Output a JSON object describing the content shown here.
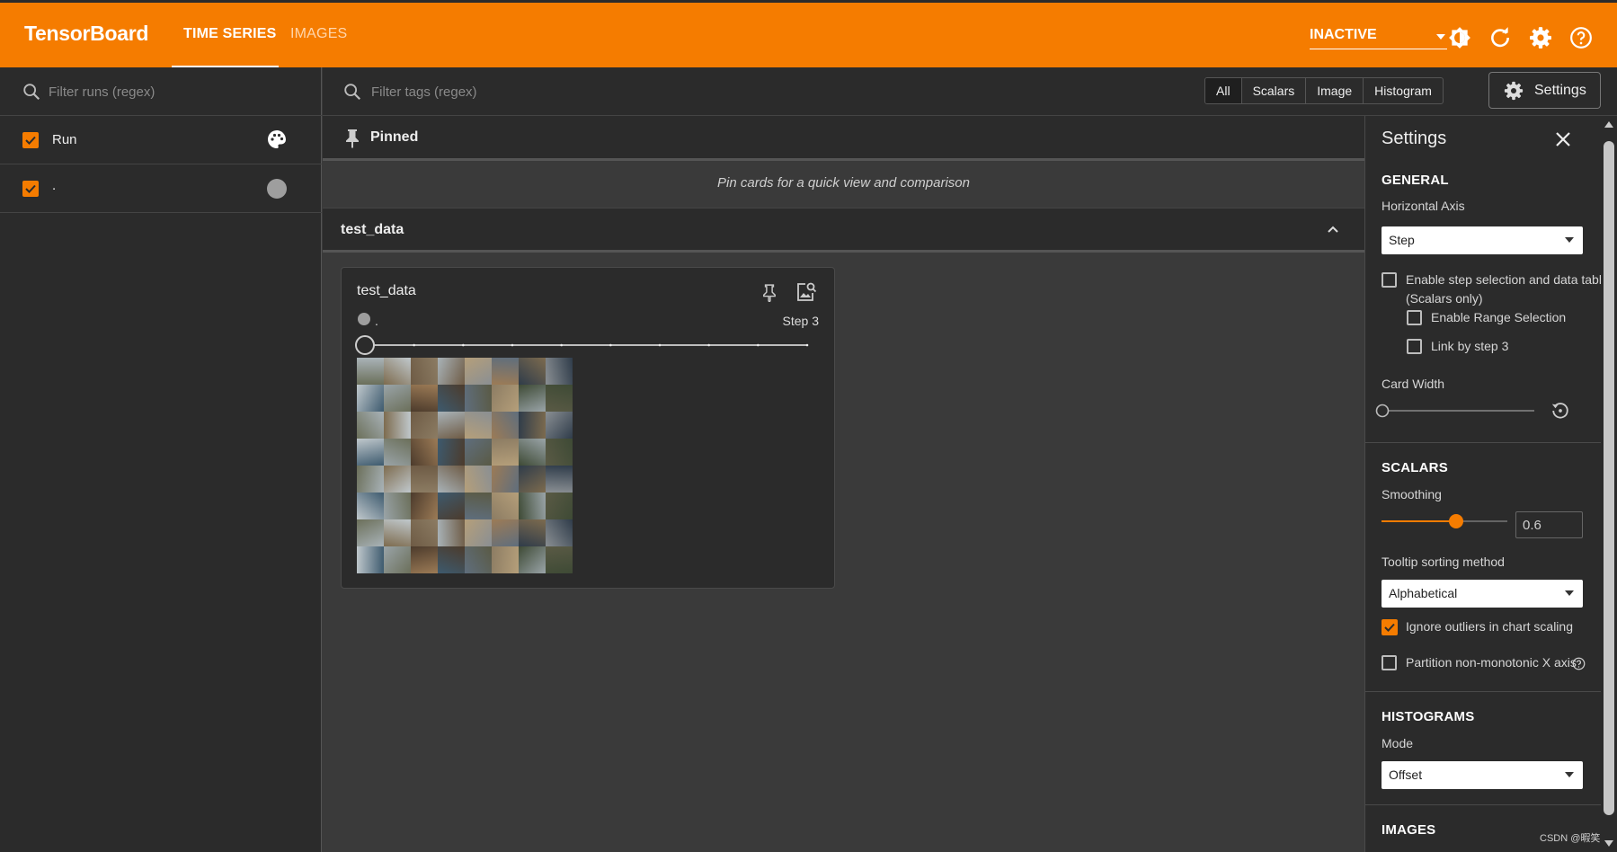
{
  "app": {
    "title": "TensorBoard"
  },
  "nav": {
    "tabs": [
      {
        "label": "TIME SERIES",
        "active": true
      },
      {
        "label": "IMAGES",
        "active": false
      }
    ],
    "reload_status": "INACTIVE"
  },
  "colors": {
    "accent": "#f57c00",
    "panel": "#2b2b2b",
    "background": "#3a3a3a"
  },
  "runs": {
    "filter_placeholder": "Filter runs (regex)",
    "header_label": "Run",
    "items": [
      {
        "name": ".",
        "checked": true,
        "color": "#9e9e9e"
      }
    ]
  },
  "main": {
    "filter_placeholder": "Filter tags (regex)",
    "type_filters": [
      "All",
      "Scalars",
      "Image",
      "Histogram"
    ],
    "settings_label": "Settings",
    "pinned": {
      "title": "Pinned",
      "empty_text": "Pin cards for a quick view and comparison"
    },
    "group": {
      "title": "test_data"
    },
    "card": {
      "title": "test_data",
      "run": ".",
      "step_label": "Step 3",
      "step_index": 0,
      "step_count": 10
    }
  },
  "settings": {
    "title": "Settings",
    "general": {
      "heading": "GENERAL",
      "horizontal_axis_label": "Horizontal Axis",
      "horizontal_axis_value": "Step",
      "step_selection_label": "Enable step selection and data table",
      "step_selection_sub": "(Scalars only)",
      "range_selection_label": "Enable Range Selection",
      "link_step_label": "Link by step 3",
      "card_width_label": "Card Width"
    },
    "scalars": {
      "heading": "SCALARS",
      "smoothing_label": "Smoothing",
      "smoothing_value": "0.6",
      "tooltip_label": "Tooltip sorting method",
      "tooltip_value": "Alphabetical",
      "ignore_outliers_label": "Ignore outliers in chart scaling",
      "partition_label": "Partition non-monotonic X axis"
    },
    "histograms": {
      "heading": "HISTOGRAMS",
      "mode_label": "Mode",
      "mode_value": "Offset"
    },
    "images": {
      "heading": "IMAGES"
    }
  },
  "watermark": "CSDN @暇笑"
}
